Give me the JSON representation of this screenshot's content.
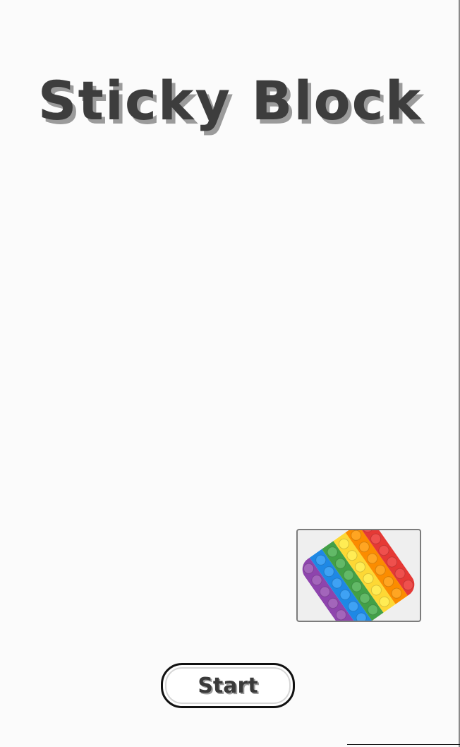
{
  "game": {
    "title": "Sticky Block",
    "start_label": "Start",
    "preview_image": "rainbow-pop-it-fidget-toy",
    "colors": {
      "title": "#3d3d3d",
      "title_shadow": "#9b9b9b",
      "rainbow": [
        "#e53935",
        "#fb8c00",
        "#fdd835",
        "#43a047",
        "#1e88e5",
        "#8e44ad"
      ]
    }
  }
}
